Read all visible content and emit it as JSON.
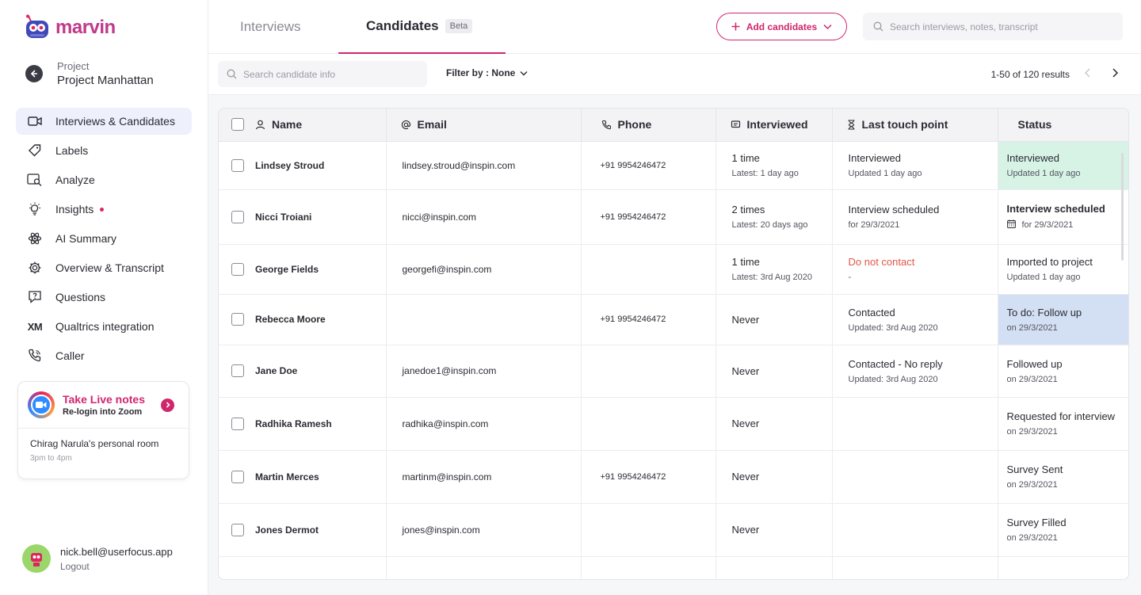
{
  "brand": {
    "name": "marvin",
    "color": "#c03a8c"
  },
  "project": {
    "label": "Project",
    "name": "Project Manhattan"
  },
  "nav": [
    {
      "label": "Interviews & Candidates",
      "icon": "video-icon",
      "active": true
    },
    {
      "label": "Labels",
      "icon": "tag-icon"
    },
    {
      "label": "Analyze",
      "icon": "analyze-icon"
    },
    {
      "label": "Insights",
      "icon": "bulb-icon",
      "dot": true
    },
    {
      "label": "AI Summary",
      "icon": "ai-icon"
    },
    {
      "label": "Overview & Transcript",
      "icon": "gear-icon"
    },
    {
      "label": "Questions",
      "icon": "questions-icon"
    },
    {
      "label": "Qualtrics integration",
      "icon": "xm-icon",
      "glyph": "XM"
    },
    {
      "label": "Caller",
      "icon": "phone-icon"
    }
  ],
  "zoom": {
    "title": "Take Live notes",
    "subtitle": "Re-login into Zoom",
    "room": "Chirag Narula's personal room",
    "time": "3pm to 4pm"
  },
  "user": {
    "email": "nick.bell@userfocus.app",
    "logout": "Logout"
  },
  "tabs": {
    "interviews": "Interviews",
    "candidates": "Candidates",
    "beta": "Beta"
  },
  "add_button": "Add candidates",
  "search_top": {
    "placeholder": "Search interviews, notes, transcript"
  },
  "search_candidate": {
    "placeholder": "Search candidate info"
  },
  "filter": "Filter by : None",
  "results": "1-50 of 120 results",
  "columns": {
    "name": "Name",
    "email": "Email",
    "phone": "Phone",
    "interviewed": "Interviewed",
    "last_touch": "Last touch point",
    "status": "Status"
  },
  "rows": [
    {
      "name": "Lindsey Stroud",
      "email": "lindsey.stroud@inspin.com",
      "phone": "+91 9954246472",
      "interviewed": "1 time",
      "interviewed_sub": "Latest: 1 day ago",
      "touch": "Interviewed",
      "touch_sub": "Updated 1 day ago",
      "status": "Interviewed",
      "status_sub": "Updated 1 day ago",
      "status_style": "green"
    },
    {
      "name": "Nicci Troiani",
      "email": "nicci@inspin.com",
      "phone": "+91 9954246472",
      "interviewed": "2 times",
      "interviewed_sub": "Latest: 20 days ago",
      "touch": "Interview scheduled",
      "touch_sub": "for 29/3/2021",
      "status": "Interview scheduled",
      "status_sub": "for 29/3/2021",
      "status_style": "bold-cal"
    },
    {
      "name": "George Fields",
      "email": "georgefi@inspin.com",
      "phone": "",
      "interviewed": "1 time",
      "interviewed_sub": "Latest: 3rd Aug 2020",
      "touch": "Do not contact",
      "touch_sub": "-",
      "touch_style": "red",
      "status": "Imported to project",
      "status_sub": "Updated 1 day ago",
      "status_style": ""
    },
    {
      "name": "Rebecca Moore",
      "email": "",
      "phone": "+91 9954246472",
      "interviewed": "Never",
      "interviewed_sub": "",
      "touch": "Contacted",
      "touch_sub": "Updated: 3rd Aug 2020",
      "status": "To do: Follow up",
      "status_sub": "on 29/3/2021",
      "status_style": "blue"
    },
    {
      "name": "Jane Doe",
      "email": "janedoe1@inspin.com",
      "phone": "",
      "interviewed": "Never",
      "interviewed_sub": "",
      "touch": "Contacted - No reply",
      "touch_sub": "Updated: 3rd Aug 2020",
      "status": "Followed up",
      "status_sub": "on 29/3/2021",
      "status_style": ""
    },
    {
      "name": "Radhika Ramesh",
      "email": "radhika@inspin.com",
      "phone": "",
      "interviewed": "Never",
      "interviewed_sub": "",
      "touch": "",
      "touch_sub": "",
      "status": "Requested for interview",
      "status_sub": "on 29/3/2021",
      "status_style": ""
    },
    {
      "name": "Martin Merces",
      "email": "martinm@inspin.com",
      "phone": "+91 9954246472",
      "interviewed": "Never",
      "interviewed_sub": "",
      "touch": "",
      "touch_sub": "",
      "status": "Survey Sent",
      "status_sub": "on 29/3/2021",
      "status_style": ""
    },
    {
      "name": "Jones Dermot",
      "email": "jones@inspin.com",
      "phone": "",
      "interviewed": "Never",
      "interviewed_sub": "",
      "touch": "",
      "touch_sub": "",
      "status": "Survey Filled",
      "status_sub": "on 29/3/2021",
      "status_style": ""
    }
  ]
}
